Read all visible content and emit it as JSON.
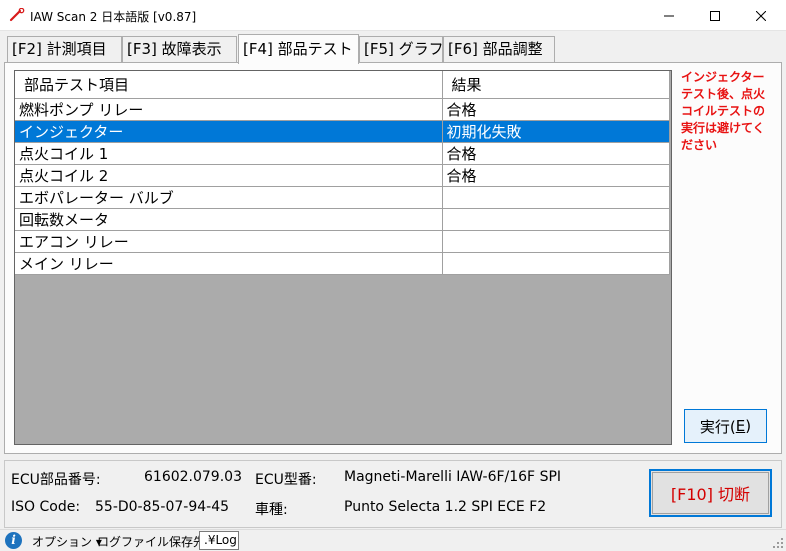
{
  "window": {
    "title": "IAW Scan 2 日本語版 [v0.87]"
  },
  "tabs": [
    {
      "label": "[F2] 計測項目"
    },
    {
      "label": "[F3] 故障表示"
    },
    {
      "label": "[F4] 部品テスト"
    },
    {
      "label": "[F5] グラフ"
    },
    {
      "label": "[F6] 部品調整"
    }
  ],
  "active_tab": "[F4] 部品テスト",
  "grid": {
    "headers": {
      "item": "部品テスト項目",
      "result": "結果"
    },
    "rows": [
      {
        "item": "燃料ポンプ リレー",
        "result": "合格"
      },
      {
        "item": "インジェクター",
        "result": "初期化失敗"
      },
      {
        "item": "点火コイル 1",
        "result": "合格"
      },
      {
        "item": "点火コイル 2",
        "result": "合格"
      },
      {
        "item": "エボパレーター バルブ",
        "result": ""
      },
      {
        "item": "回転数メータ",
        "result": ""
      },
      {
        "item": "エアコン リレー",
        "result": ""
      },
      {
        "item": "メイン リレー",
        "result": ""
      }
    ],
    "selected_row": "インジェクター"
  },
  "warning_text": "インジェクターテスト後、点火コイルテストの実行は避けてください",
  "run_button": {
    "label": "実行(",
    "accel": "E",
    "close": ")"
  },
  "info": {
    "ecu_part_label": "ECU部品番号:",
    "ecu_part_value": "61602.079.03",
    "ecu_model_label": "ECU型番:",
    "ecu_model_value": "Magneti-Marelli IAW-6F/16F SPI",
    "iso_label": "ISO Code:",
    "iso_value": "55-D0-85-07-94-45",
    "vehicle_label": "車種:",
    "vehicle_value": "Punto Selecta 1.2 SPI ECE F2"
  },
  "disconnect_button": {
    "label": "[F10] 切断"
  },
  "statusbar": {
    "options_label": "オプション ▾",
    "log_label": "ログファイル保存先：",
    "log_path": ".¥Log"
  },
  "colors": {
    "selection": "#0078d7",
    "warning": "#e81212",
    "disconnect_text": "#d40000",
    "grid_empty": "#ababab"
  },
  "icons": {
    "app": "app-wrench-icon",
    "info": "info-icon",
    "minimize": "minimize-icon",
    "maximize": "maximize-icon",
    "close": "close-icon"
  }
}
